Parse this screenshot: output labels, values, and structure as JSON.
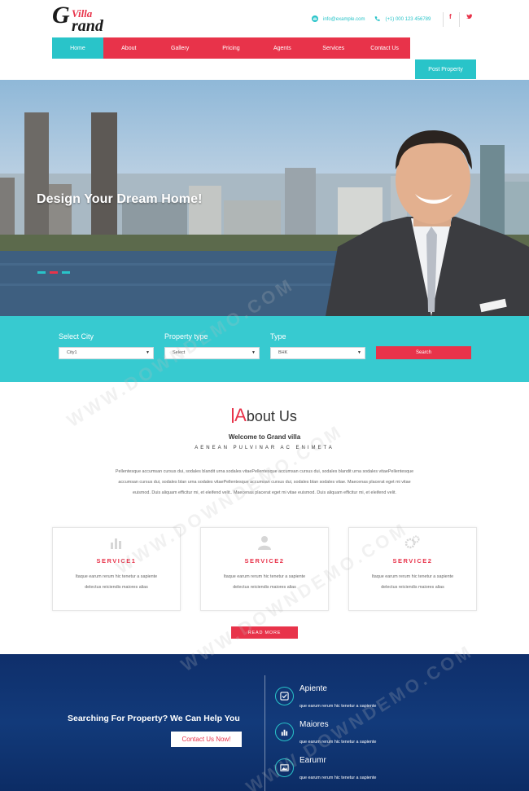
{
  "brand": {
    "initial": "G",
    "top_word": "Villa",
    "rest_word": "rand"
  },
  "header": {
    "email": "info@example.com",
    "phone": "(+1) 000 123 456789",
    "social": [
      "f",
      "t"
    ]
  },
  "nav": {
    "items": [
      "Home",
      "About",
      "Gallery",
      "Pricing",
      "Agents",
      "Services",
      "Contact Us"
    ],
    "active_index": 0,
    "post_property": "Post Property"
  },
  "hero": {
    "title": "Design Your Dream Home!",
    "slides": 3
  },
  "search": {
    "city_label": "Select City",
    "city_value": "City1",
    "type_label": "Property type",
    "type_value": "Select",
    "bhk_label": "Type",
    "bhk_value": "BHK",
    "button": "Search"
  },
  "about": {
    "title_first": "A",
    "title_rest": "bout Us",
    "welcome": "Welcome to Grand villa",
    "tagline": "AENEAN PULVINAR AC ENIMETA",
    "body": "Pellentesque accumsan cursus dui, sodales blandit urna sodales vitaePellentesque accumsan cursus dui, sodales blandit urna sodales vitaePellentesque accumsan cursus dui, sodales blan urna sodales vitaePellentesque accumsan cursus dui, sodales blan sodales vitae. Maecenas placerat eget mi vitae euismod. Duis aliquam efficitur mi, et eleifend velit.. Maecenas placerat eget mi vitae euismod. Duis aliquam efficitur mi, et eleifend velit.",
    "services": [
      {
        "name": "SERVICE1",
        "icon": "bar-chart-icon",
        "desc": "Itaque earum rerum hic tenetur a sapiente delectus reiciendis maiores alias"
      },
      {
        "name": "SERVICE2",
        "icon": "user-icon",
        "desc": "Itaque earum rerum hic tenetur a sapiente delectus reiciendis maiores alias"
      },
      {
        "name": "SERVICE2",
        "icon": "gears-icon",
        "desc": "Itaque earum rerum hic tenetur a sapiente delectus reiciendis maiores alias"
      }
    ],
    "read_more": "READ MORE"
  },
  "help": {
    "headline": "Searching For Property? We Can Help You",
    "cta": "Contact Us Now!",
    "features": [
      {
        "title": "Apiente",
        "sub": "que earum rerum hic tenetur a sapiente",
        "icon": "check-icon"
      },
      {
        "title": "Maiores",
        "sub": "que earum rerum hic tenetur a sapiente",
        "icon": "bar-chart-icon"
      },
      {
        "title": "Earumr",
        "sub": "que earum rerum hic tenetur a sapiente",
        "icon": "image-icon"
      }
    ]
  },
  "colors": {
    "primary_red": "#e8334a",
    "accent_cyan": "#29c4c9",
    "navy": "#123a7a"
  },
  "watermark": "WWW.DOWNDEMO.COM"
}
